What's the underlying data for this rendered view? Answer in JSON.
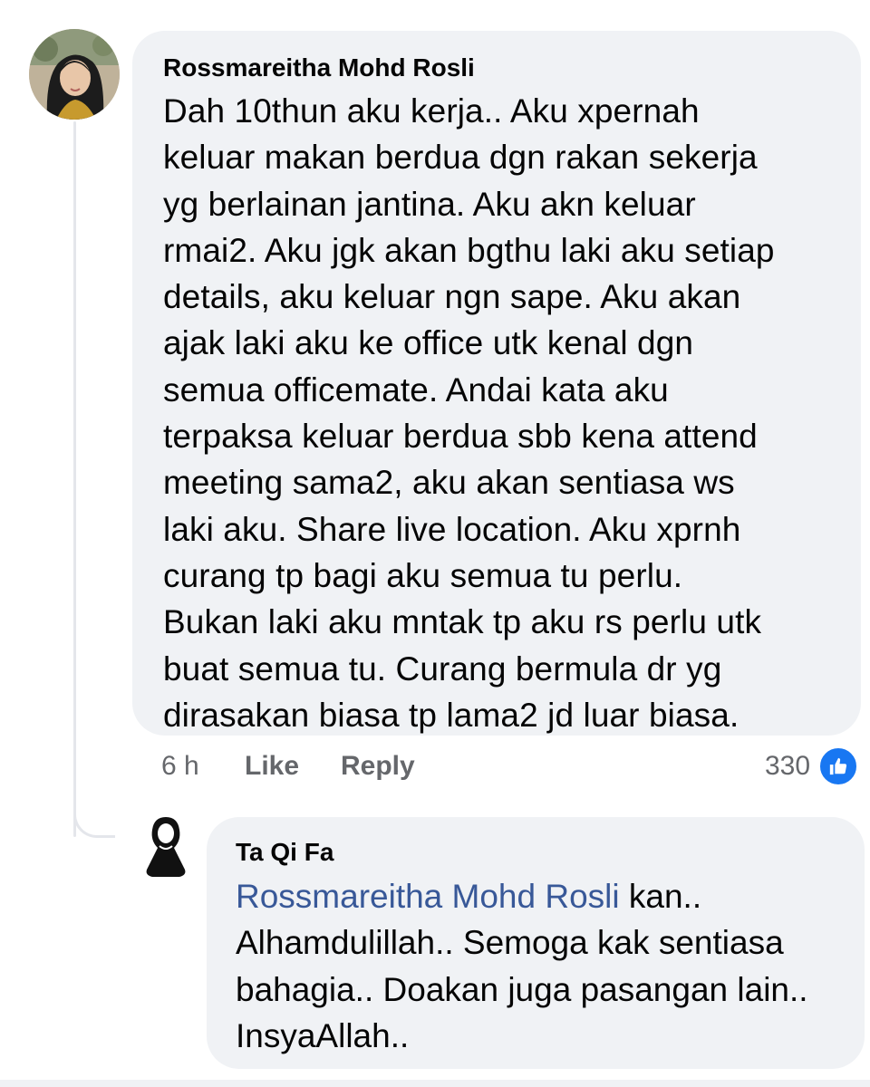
{
  "comment": {
    "author": "Rossmareitha Mohd Rosli",
    "text": "Dah 10thun aku kerja.. Aku xpernah\nkeluar makan berdua dgn rakan sekerja\nyg berlainan jantina. Aku akn keluar\nrmai2. Aku jgk akan bgthu laki aku setiap\ndetails, aku keluar ngn sape.  Aku akan\najak laki aku ke office utk kenal dgn\nsemua officemate.  Andai kata aku\nterpaksa keluar berdua sbb kena attend\nmeeting sama2, aku akan sentiasa ws\nlaki aku. Share live location.  Aku xprnh\ncurang tp bagi aku semua tu perlu.\nBukan laki aku mntak tp aku rs perlu utk\nbuat semua tu.  Curang bermula dr yg\ndirasakan biasa tp lama2 jd luar biasa.",
    "time": "6 h",
    "like_label": "Like",
    "reply_label": "Reply",
    "reaction_count": "330",
    "reaction_icon": "like-icon"
  },
  "reply": {
    "author": "Ta Qi Fa",
    "mention": "Rossmareitha Mohd Rosli",
    "text_line1_rest": " kan..",
    "text_rest": "Alhamdulillah.. Semoga kak sentiasa bahagia.. Doakan juga pasangan lain.. InsyaAllah.."
  },
  "colors": {
    "bubble": "#f0f2f5",
    "mention": "#385898",
    "meta": "#65676b",
    "like_blue": "#1877f2"
  }
}
